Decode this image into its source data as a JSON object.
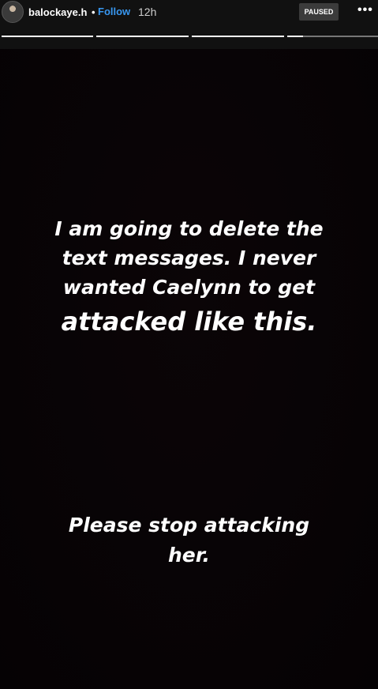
{
  "header": {
    "username": "balockaye.h",
    "separator": "•",
    "follow_label": "Follow",
    "time": "12h",
    "status_badge": "PAUSED",
    "more_icon": "•••"
  },
  "story": {
    "progress": {
      "segments": 4,
      "current_segment": 4
    },
    "message_1": {
      "line_1": "I am going to delete the",
      "line_2": "text messages. I never",
      "line_3": "wanted Caelynn to get",
      "line_4": "attacked like this."
    },
    "message_2": {
      "line_1": "Please stop attacking",
      "line_2": "her."
    }
  },
  "colors": {
    "accent": "#3897f0",
    "background": "#080406",
    "text": "#ffffff",
    "header_bg": "#111111",
    "badge_bg": "#3b3b3b"
  }
}
